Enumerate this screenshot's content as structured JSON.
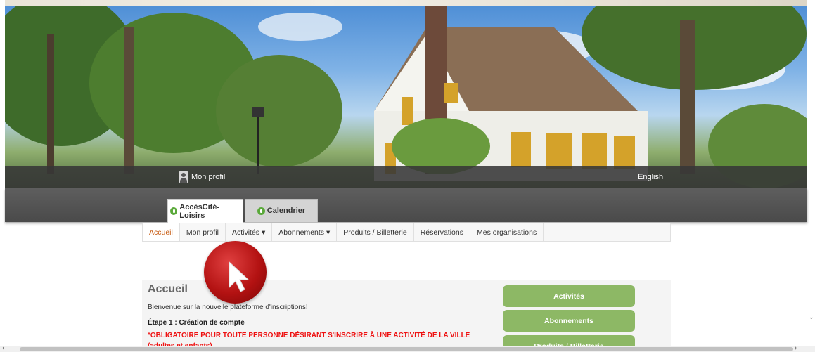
{
  "header": {
    "profile_label": "Mon profil",
    "language_label": "English"
  },
  "tabs": [
    {
      "label": "AccèsCité-Loisirs"
    },
    {
      "label": "Calendrier"
    }
  ],
  "menu": [
    {
      "label": "Accueil",
      "active": true
    },
    {
      "label": "Mon profil"
    },
    {
      "label": "Activités ▾"
    },
    {
      "label": "Abonnements ▾"
    },
    {
      "label": "Produits / Billetterie"
    },
    {
      "label": "Réservations"
    },
    {
      "label": "Mes organisations"
    }
  ],
  "main": {
    "title": "Accueil",
    "welcome": "Bienvenue sur la nouvelle plateforme d'inscriptions!",
    "step1": "Étape 1 : Création de compte",
    "warning": "*OBLIGATOIRE POUR TOUTE PERSONNE DÉSIRANT S'INSCRIRE À UNE ACTIVITÉ DE LA VILLE (adultes et enfants)"
  },
  "sidebar_buttons": [
    {
      "label": "Activités"
    },
    {
      "label": "Abonnements"
    },
    {
      "label": "Produits / Billetterie"
    }
  ],
  "colors": {
    "accent_orange": "#c75b12",
    "button_green": "#8db865",
    "warning_red": "#e11111",
    "cursor_red": "#b31212"
  },
  "icons": {
    "cursor": "mouse-pointer-arrow-icon",
    "tab_leaf": "green-leaf-icon",
    "profile": "user-avatar-icon"
  }
}
